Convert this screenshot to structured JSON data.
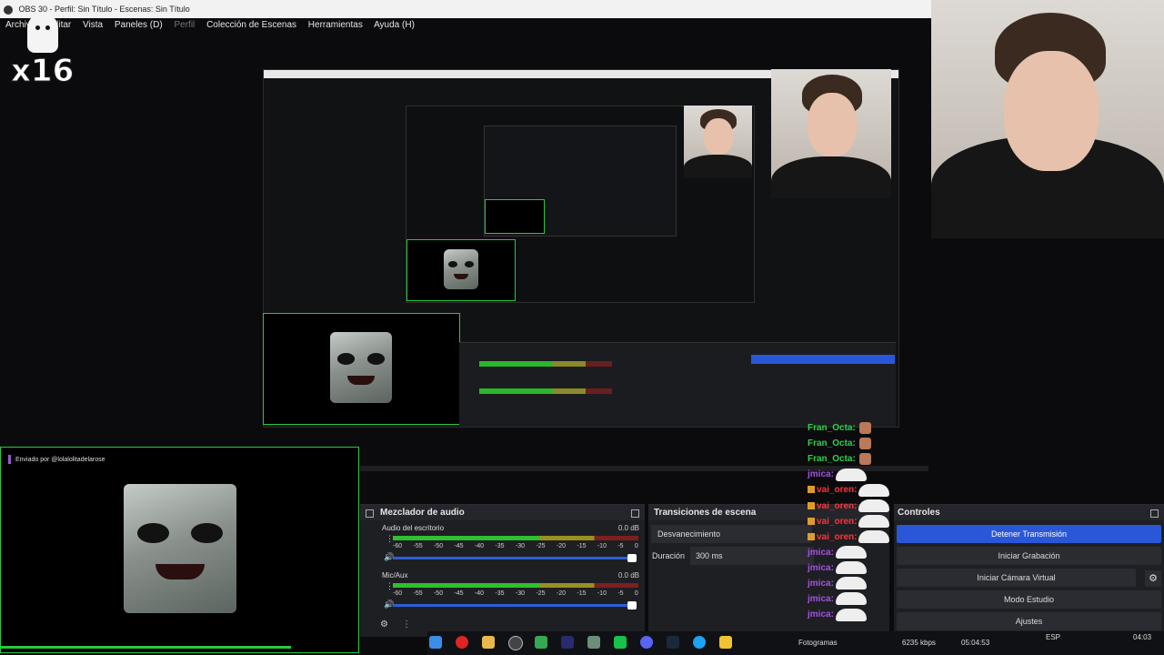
{
  "window": {
    "title": "OBS 30  - Perfil: Sin Título - Escenas: Sin Título"
  },
  "menu": {
    "items": [
      "Archivo",
      "Editar",
      "Vista",
      "Paneles (D)",
      "Perfil",
      "Colección de Escenas",
      "Herramientas",
      "Ayuda (H)"
    ]
  },
  "watermark": {
    "text": "x16"
  },
  "alert": {
    "sender": "Enviado por @lolalolitadelarose"
  },
  "mixer": {
    "title": "Mezclador de audio",
    "tracks": [
      {
        "name": "Audio del escritorio",
        "db": "0.0 dB"
      },
      {
        "name": "Mic/Aux",
        "db": "0.0 dB"
      }
    ],
    "scale": [
      "-60",
      "-55",
      "-50",
      "-45",
      "-40",
      "-35",
      "-30",
      "-25",
      "-20",
      "-15",
      "-10",
      "-5",
      "0"
    ]
  },
  "transitions": {
    "title": "Transiciones de escena",
    "selected": "Desvanecimiento",
    "duration_label": "Duración",
    "duration_value": "300 ms"
  },
  "controls": {
    "title": "Controles",
    "buttons": [
      "Detener Transmisión",
      "Iniciar Grabación",
      "Iniciar Cámara Virtual",
      "Modo Estudio",
      "Ajustes"
    ]
  },
  "chat": {
    "messages": [
      {
        "user": "Fran_Octa:",
        "color": "#2fd04a",
        "emote": true
      },
      {
        "user": "Fran_Octa:",
        "color": "#2fd04a",
        "emote": true
      },
      {
        "user": "Fran_Octa:",
        "color": "#2fd04a",
        "emote": true
      },
      {
        "user": "jmica:",
        "color": "#a552e0",
        "emote": false
      },
      {
        "user": "vai_oren:",
        "color": "#ff3535",
        "emote": false
      },
      {
        "user": "vai_oren:",
        "color": "#ff3535",
        "emote": false
      },
      {
        "user": "vai_oren:",
        "color": "#ff3535",
        "emote": false
      },
      {
        "user": "vai_oren:",
        "color": "#ff3535",
        "emote": false
      },
      {
        "user": "jmica:",
        "color": "#a552e0",
        "emote": false
      },
      {
        "user": "jmica:",
        "color": "#a552e0",
        "emote": false
      },
      {
        "user": "jmica:",
        "color": "#a552e0",
        "emote": false
      },
      {
        "user": "jmica:",
        "color": "#a552e0",
        "emote": false
      },
      {
        "user": "jmica:",
        "color": "#a552e0",
        "emote": false
      }
    ]
  },
  "statusbar": {
    "fps_label": "Fotogramas",
    "bitrate": "6235 kbps",
    "time": "05:04:53",
    "language": "ESP",
    "clock": "04:03"
  },
  "taskbar": {
    "icons": [
      "windows-icon",
      "opera-icon",
      "folder-icon",
      "obs-icon",
      "drive-icon",
      "premiere-icon",
      "tool-icon",
      "green-app-icon",
      "discord-icon",
      "steam-icon",
      "edge-icon",
      "app-icon"
    ]
  }
}
